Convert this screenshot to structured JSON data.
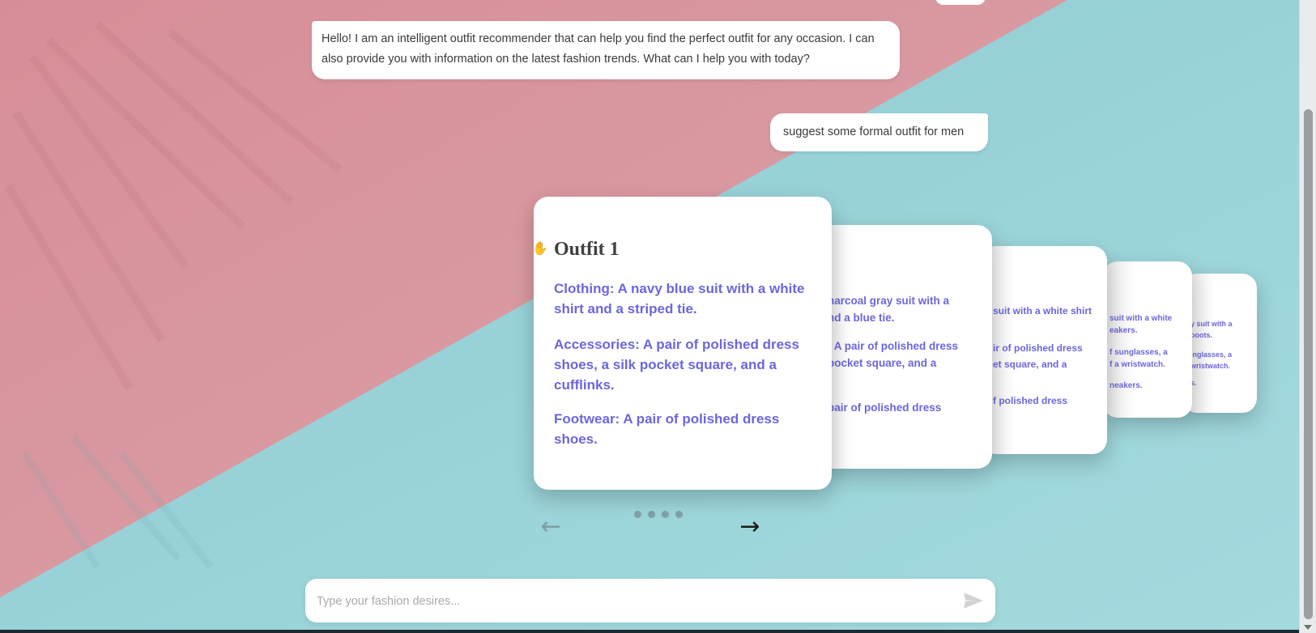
{
  "colors": {
    "pink": "#dc9aa2",
    "teal": "#93cfd6",
    "accent_text": "#6c66dc",
    "card_bg": "#ffffff"
  },
  "chat": {
    "bot_message": "Hello! I am an intelligent outfit recommender that can help you find the perfect outfit for any occasion. I can also provide you with information on the latest fashion trends. What can I help you with today?",
    "user_message": "suggest some formal outfit for men"
  },
  "carousel": {
    "active_card": {
      "title": "Outfit 1",
      "clothing": "Clothing: A navy blue suit with a white shirt and a striped tie.",
      "accessories": "Accessories: A pair of polished dress shoes, a silk pocket square, and a cufflinks.",
      "footwear": "Footwear: A pair of polished dress shoes."
    },
    "card2": {
      "line1": "harcoal gray suit with a",
      "line2": "nd a blue tie.",
      "line3": ": A pair of polished dress",
      "line4": "pocket square, and a",
      "line5": "pair of polished dress"
    },
    "card3": {
      "line1": "suit with a white shirt",
      "line2": "ir of polished dress",
      "line3": "et square, and a",
      "line4": "f polished dress"
    },
    "card4": {
      "line1": "suit with a white",
      "line2": "eakers.",
      "line3": "f sunglasses, a",
      "line4": "f a wristwatch.",
      "line5": "neakers."
    },
    "card5": {
      "line1": "y suit with a",
      "line2": "boots.",
      "line3": "inglasses, a",
      "line4": "wristwatch.",
      "line5": "s."
    },
    "pagination_dot_count": 4,
    "prev_icon": "arrow-left-icon",
    "next_icon": "arrow-right-icon",
    "cursor_icon": "hand-pointer-icon"
  },
  "composer": {
    "placeholder": "Type your fashion desires...",
    "value": "",
    "send_icon": "send-icon"
  }
}
